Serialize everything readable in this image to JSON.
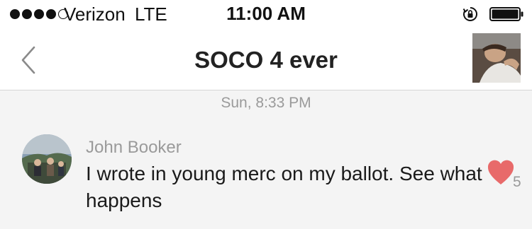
{
  "status_bar": {
    "signal_icon": "cellular-signal-icon",
    "carrier": "Verizon",
    "network": "LTE",
    "time": "11:00 AM",
    "lock_icon": "orientation-lock-icon",
    "battery_icon": "battery-icon"
  },
  "nav": {
    "back_icon": "chevron-left-icon",
    "title": "SOCO 4 ever",
    "avatar_icon": "group-avatar"
  },
  "chat": {
    "timestamp": "Sun, 8:33 PM",
    "messages": [
      {
        "sender": "John Booker",
        "text": "I wrote in young merc on my ballot. See what happens",
        "like_icon": "heart-icon",
        "likes": "5",
        "like_color": "#e86a6a"
      }
    ]
  }
}
